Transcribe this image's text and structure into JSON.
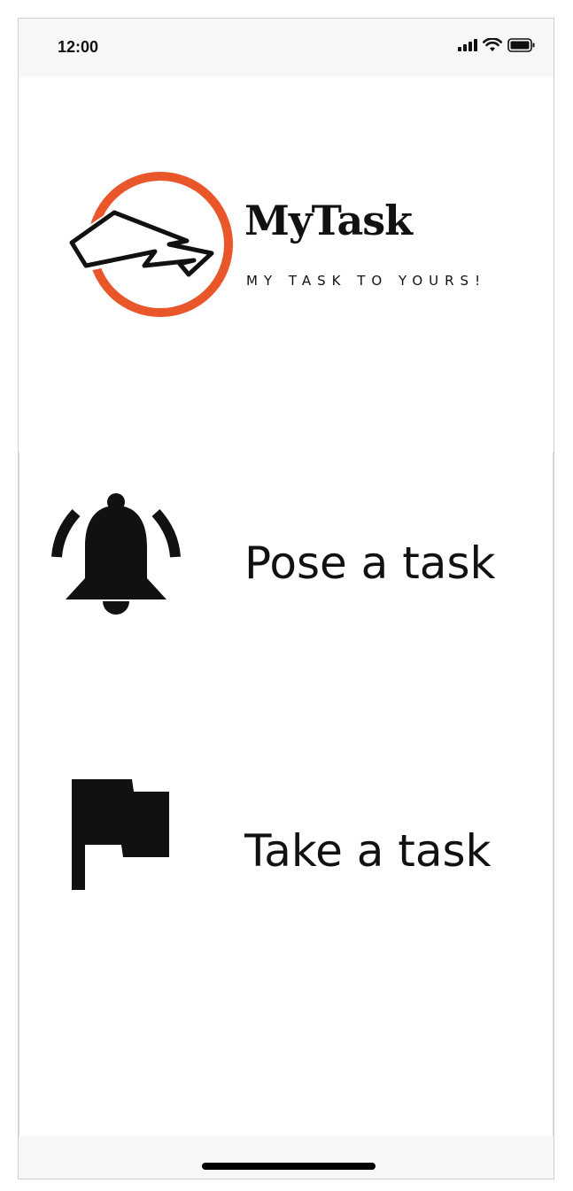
{
  "status_bar": {
    "time": "12:00",
    "icons": [
      "cellular-signal-icon",
      "wifi-icon",
      "battery-icon"
    ]
  },
  "brand": {
    "name": "MyTask",
    "tagline": "MY TASK TO YOURS!",
    "accent_color": "#E8562A"
  },
  "menu": {
    "items": [
      {
        "label": "Pose a task",
        "icon": "bell-icon"
      },
      {
        "label": "Take a task",
        "icon": "flag-icon"
      }
    ]
  }
}
